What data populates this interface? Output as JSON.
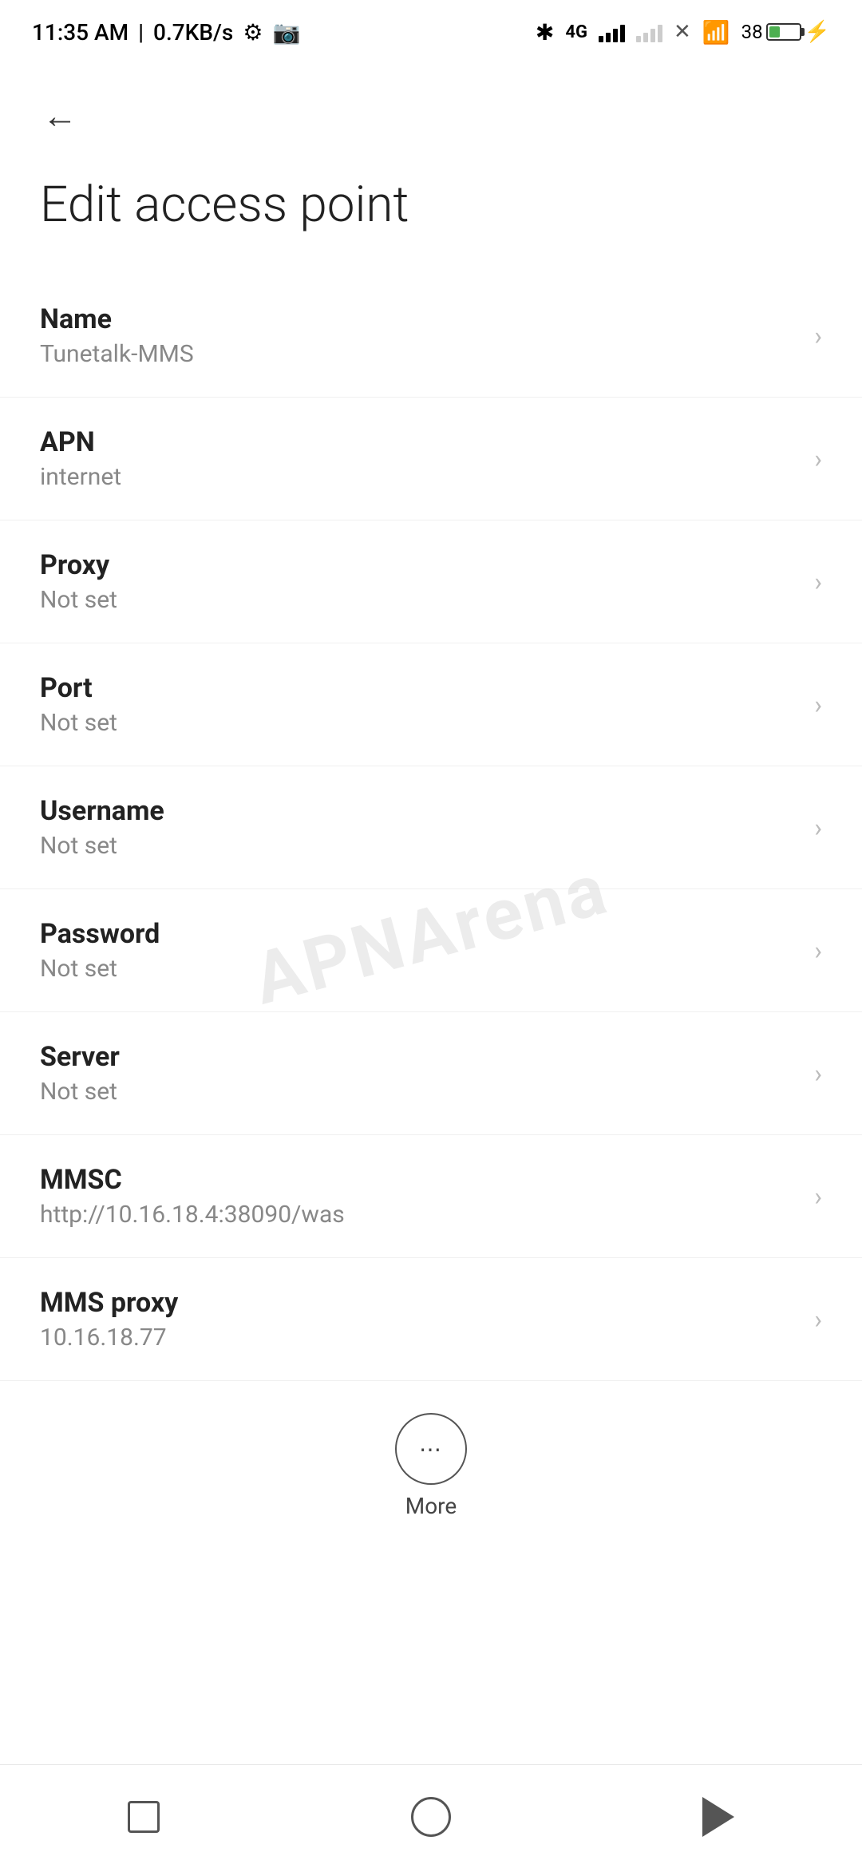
{
  "statusBar": {
    "time": "11:35 AM",
    "speed": "0.7KB/s"
  },
  "header": {
    "backLabel": "←",
    "title": "Edit access point"
  },
  "settings": {
    "items": [
      {
        "label": "Name",
        "value": "Tunetalk-MMS"
      },
      {
        "label": "APN",
        "value": "internet"
      },
      {
        "label": "Proxy",
        "value": "Not set"
      },
      {
        "label": "Port",
        "value": "Not set"
      },
      {
        "label": "Username",
        "value": "Not set"
      },
      {
        "label": "Password",
        "value": "Not set"
      },
      {
        "label": "Server",
        "value": "Not set"
      },
      {
        "label": "MMSC",
        "value": "http://10.16.18.4:38090/was"
      },
      {
        "label": "MMS proxy",
        "value": "10.16.18.77"
      }
    ]
  },
  "more": {
    "label": "More"
  },
  "watermark": "APNArena"
}
